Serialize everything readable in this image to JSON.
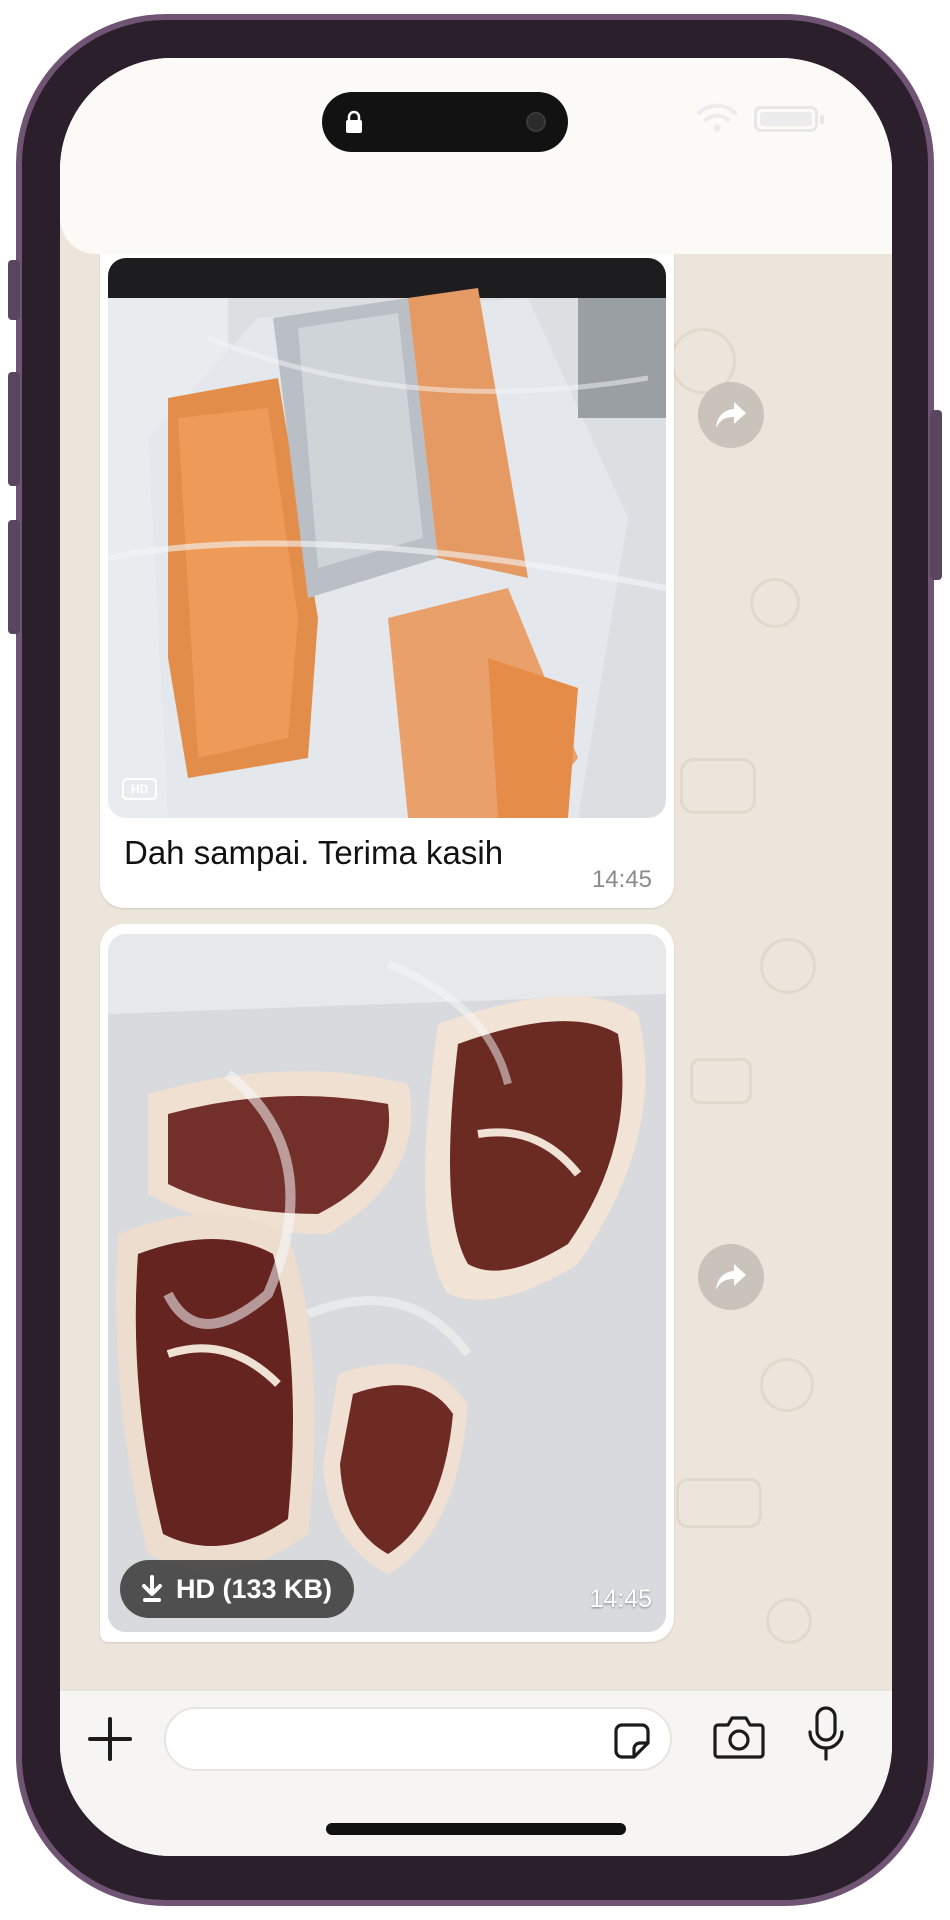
{
  "messages": [
    {
      "image_desc": "Vacuum-packed salmon fillets",
      "hd_badge": "HD",
      "caption": "Dah sampai. Terima kasih",
      "time": "14:45"
    },
    {
      "image_desc": "Vacuum-packed raw beef steaks",
      "download_label": "HD (133 KB)",
      "time": "14:45"
    }
  ],
  "colors": {
    "frame": "#6f5573",
    "wallpaper": "#ece5dc",
    "bubble": "#ffffff",
    "forward_button": "#c9c3bb"
  },
  "icons": [
    "lock-icon",
    "wifi-icon",
    "battery-icon",
    "forward-icon",
    "download-icon",
    "plus-icon",
    "sticker-icon",
    "camera-icon",
    "mic-icon"
  ]
}
